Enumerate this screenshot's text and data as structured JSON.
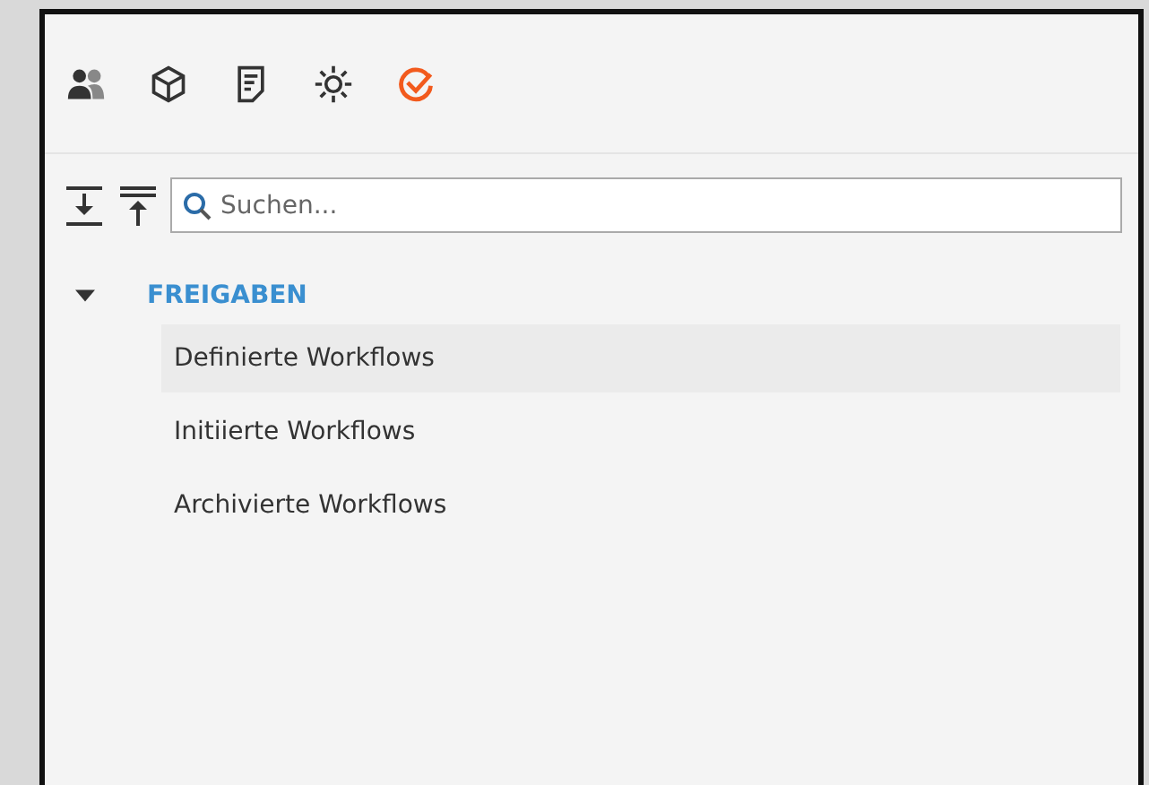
{
  "toolbar": {
    "tabs": [
      {
        "kind": "users",
        "selected": false
      },
      {
        "kind": "cube",
        "selected": false
      },
      {
        "kind": "document",
        "selected": false
      },
      {
        "kind": "gear",
        "selected": false
      },
      {
        "kind": "check",
        "selected": true
      }
    ]
  },
  "search": {
    "placeholder": "Suchen..."
  },
  "tree": [
    {
      "label": "FREIGABEN",
      "expanded": true,
      "children": [
        {
          "label": "Definierte Workflows",
          "selected": true
        },
        {
          "label": "Initiierte Workflows",
          "selected": false
        },
        {
          "label": "Archivierte Workflows",
          "selected": false
        }
      ]
    }
  ]
}
